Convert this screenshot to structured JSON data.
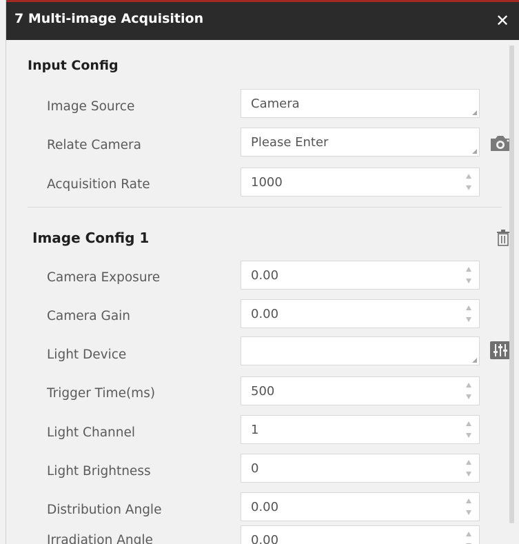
{
  "window": {
    "title": "7 Multi-image Acquisition",
    "close_glyph": "✕"
  },
  "input_config": {
    "heading": "Input Config",
    "rows": [
      {
        "label": "Image Source",
        "value": "Camera",
        "kind": "select"
      },
      {
        "label": "Relate Camera",
        "value": "Please Enter",
        "kind": "select"
      },
      {
        "label": "Acquisition Rate",
        "value": "1000",
        "kind": "spin"
      }
    ]
  },
  "image_config": {
    "heading": "Image Config 1",
    "rows": [
      {
        "label": "Camera Exposure",
        "value": "0.00",
        "kind": "spin"
      },
      {
        "label": "Camera Gain",
        "value": "0.00",
        "kind": "spin"
      },
      {
        "label": "Light Device",
        "value": "",
        "kind": "select"
      },
      {
        "label": "Trigger Time(ms)",
        "value": "500",
        "kind": "spin"
      },
      {
        "label": "Light Channel",
        "value": "1",
        "kind": "spin"
      },
      {
        "label": "Light Brightness",
        "value": "0",
        "kind": "spin"
      },
      {
        "label": "Distribution Angle",
        "value": "0.00",
        "kind": "spin"
      },
      {
        "label": "Irradiation Angle",
        "value": "0.00",
        "kind": "spin"
      }
    ]
  },
  "icons": {
    "camera": "camera-icon",
    "delete": "trash-icon",
    "light_settings": "sliders-icon"
  },
  "colors": {
    "titlebar": "#2b2b2b",
    "accent": "#a32a24",
    "panel": "#f1f1f1"
  }
}
